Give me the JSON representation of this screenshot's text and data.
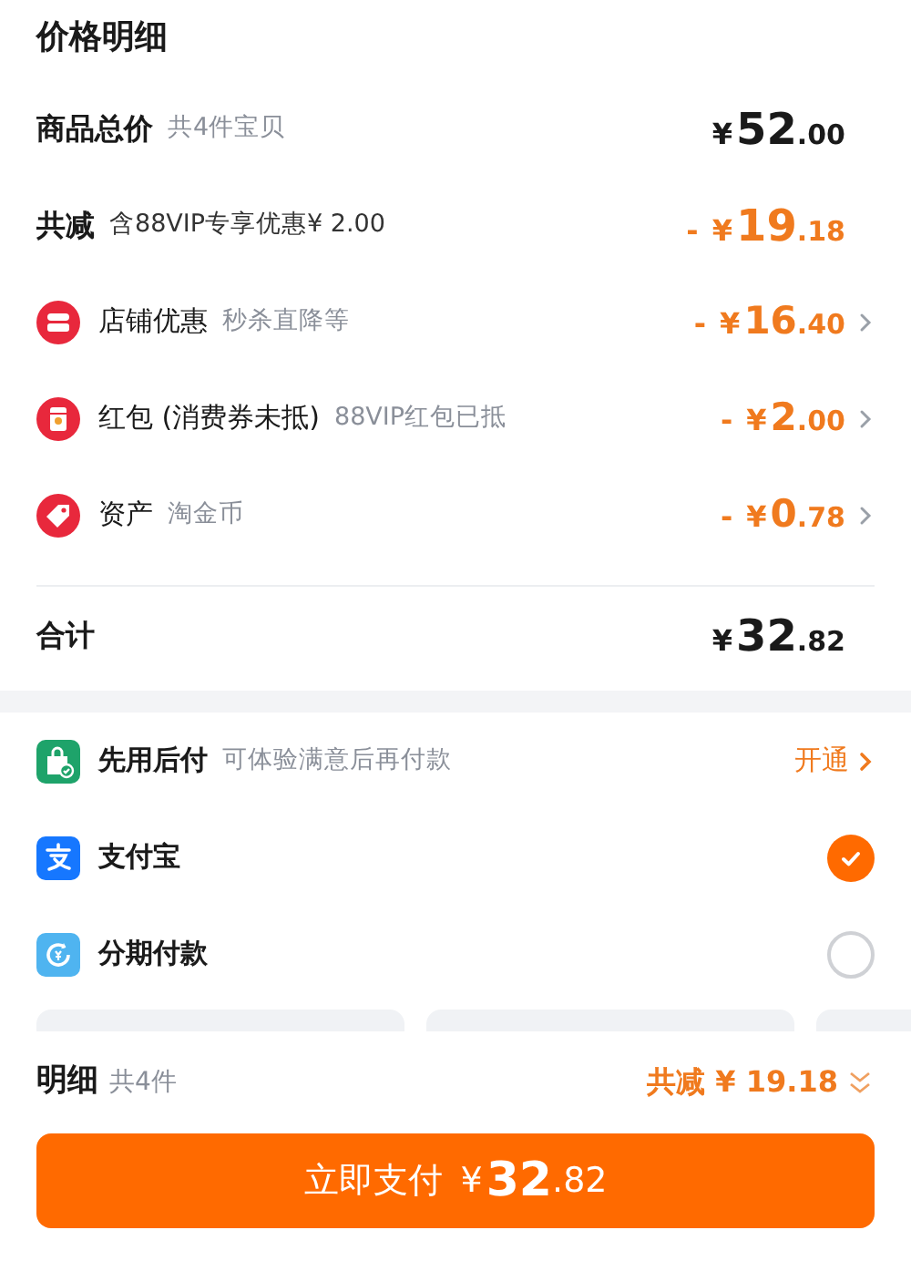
{
  "title": "价格明细",
  "summary_rows": [
    {
      "kind": "plain",
      "label": "商品总价",
      "note": "共4件宝贝",
      "amount": {
        "currency": "¥",
        "integer": "52",
        "decimal": ".00"
      },
      "discount": false,
      "chevron": false
    },
    {
      "kind": "plain",
      "label": "共减",
      "note": "含88VIP专享优惠¥ 2.00",
      "amount": {
        "sign": "-",
        "currency": "¥",
        "integer": "19",
        "decimal": ".18"
      },
      "discount": true,
      "chevron": false
    },
    {
      "kind": "store",
      "label": "店铺优惠",
      "note": "秒杀直降等",
      "amount": {
        "sign": "-",
        "currency": "¥",
        "integer": "16",
        "decimal": ".40"
      },
      "discount": true,
      "chevron": true
    },
    {
      "kind": "redpacket",
      "label": "红包 (消费券未抵)",
      "note": "88VIP红包已抵",
      "amount": {
        "sign": "-",
        "currency": "¥",
        "integer": "2",
        "decimal": ".00"
      },
      "discount": true,
      "chevron": true
    },
    {
      "kind": "asset",
      "label": "资产",
      "note": "淘金币",
      "amount": {
        "sign": "-",
        "currency": "¥",
        "integer": "0",
        "decimal": ".78"
      },
      "discount": true,
      "chevron": true
    }
  ],
  "total": {
    "label": "合计",
    "amount": {
      "currency": "¥",
      "integer": "32",
      "decimal": ".82"
    }
  },
  "payment_methods": [
    {
      "kind": "paylater",
      "label": "先用后付",
      "note": "可体验满意后再付款",
      "action": "开通"
    },
    {
      "kind": "alipay",
      "label": "支付宝",
      "selected": true
    },
    {
      "kind": "installment",
      "label": "分期付款",
      "selected": false
    }
  ],
  "footer": {
    "label": "明细",
    "count": "共4件",
    "discount": "共减 ¥ 19.18"
  },
  "pay_button": {
    "label": "立即支付",
    "amount": {
      "currency": "¥",
      "integer": "32",
      "decimal": ".82"
    }
  }
}
